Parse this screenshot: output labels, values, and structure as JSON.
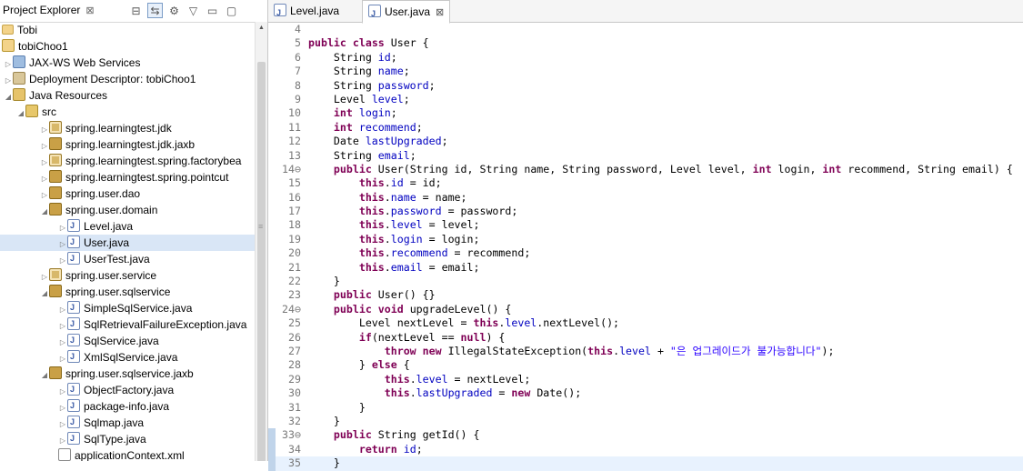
{
  "explorer": {
    "title": "Project Explorer",
    "close_glyph": "⊠",
    "toolbar": [
      {
        "icon": "collapse-all-icon",
        "glyph": "⊟",
        "active": false
      },
      {
        "icon": "link-with-editor-icon",
        "glyph": "⇆",
        "active": true
      },
      {
        "icon": "filter-icon",
        "glyph": "⚙",
        "active": false
      },
      {
        "icon": "view-menu-icon",
        "glyph": "▽",
        "active": false
      },
      {
        "icon": "minimize-icon",
        "glyph": "▭",
        "active": false
      },
      {
        "icon": "maximize-icon",
        "glyph": "▢",
        "active": false
      }
    ],
    "tree": [
      {
        "label": "Tobi",
        "indent": 0,
        "toggle": "",
        "icon": "folder"
      },
      {
        "label": "tobiChoo1",
        "indent": 0,
        "toggle": "",
        "icon": "project"
      },
      {
        "label": "JAX-WS Web Services",
        "indent": 1,
        "toggle": "▷",
        "icon": "ws"
      },
      {
        "label": "Deployment Descriptor: tobiChoo1",
        "indent": 1,
        "toggle": "▷",
        "icon": "dd"
      },
      {
        "label": "Java Resources",
        "indent": 1,
        "toggle": "◢",
        "icon": "jr"
      },
      {
        "label": "src",
        "indent": 2,
        "toggle": "◢",
        "icon": "src"
      },
      {
        "label": "spring.learningtest.jdk",
        "indent": 3,
        "toggle": "▷",
        "icon": "pkgw"
      },
      {
        "label": "spring.learningtest.jdk.jaxb",
        "indent": 3,
        "toggle": "▷",
        "icon": "pkg"
      },
      {
        "label": "spring.learningtest.spring.factorybea",
        "indent": 3,
        "toggle": "▷",
        "icon": "pkgw"
      },
      {
        "label": "spring.learningtest.spring.pointcut",
        "indent": 3,
        "toggle": "▷",
        "icon": "pkg"
      },
      {
        "label": "spring.user.dao",
        "indent": 3,
        "toggle": "▷",
        "icon": "pkg"
      },
      {
        "label": "spring.user.domain",
        "indent": 3,
        "toggle": "◢",
        "icon": "pkg"
      },
      {
        "label": "Level.java",
        "indent": 4,
        "toggle": "▷",
        "icon": "java"
      },
      {
        "label": "User.java",
        "indent": 4,
        "toggle": "▷",
        "icon": "java",
        "selected": true
      },
      {
        "label": "UserTest.java",
        "indent": 4,
        "toggle": "▷",
        "icon": "java"
      },
      {
        "label": "spring.user.service",
        "indent": 3,
        "toggle": "▷",
        "icon": "pkgw"
      },
      {
        "label": "spring.user.sqlservice",
        "indent": 3,
        "toggle": "◢",
        "icon": "pkg"
      },
      {
        "label": "SimpleSqlService.java",
        "indent": 4,
        "toggle": "▷",
        "icon": "java"
      },
      {
        "label": "SqlRetrievalFailureException.java",
        "indent": 4,
        "toggle": "▷",
        "icon": "java"
      },
      {
        "label": "SqlService.java",
        "indent": 4,
        "toggle": "▷",
        "icon": "java"
      },
      {
        "label": "XmlSqlService.java",
        "indent": 4,
        "toggle": "▷",
        "icon": "java"
      },
      {
        "label": "spring.user.sqlservice.jaxb",
        "indent": 3,
        "toggle": "◢",
        "icon": "pkg"
      },
      {
        "label": "ObjectFactory.java",
        "indent": 4,
        "toggle": "▷",
        "icon": "java"
      },
      {
        "label": "package-info.java",
        "indent": 4,
        "toggle": "▷",
        "icon": "java"
      },
      {
        "label": "Sqlmap.java",
        "indent": 4,
        "toggle": "▷",
        "icon": "java"
      },
      {
        "label": "SqlType.java",
        "indent": 4,
        "toggle": "▷",
        "icon": "java"
      },
      {
        "label": "applicationContext.xml",
        "indent": 4,
        "toggle": "",
        "icon": "xml"
      }
    ]
  },
  "editor": {
    "tabs": [
      {
        "label": "Level.java",
        "active": false
      },
      {
        "label": "User.java",
        "active": true,
        "close": "⊠"
      }
    ],
    "lines": [
      {
        "n": "4",
        "code": ""
      },
      {
        "n": "5",
        "code": "<kw>public</kw> <kw>class</kw> User {"
      },
      {
        "n": "6",
        "code": "    String <f>id</f>;"
      },
      {
        "n": "7",
        "code": "    String <f>name</f>;"
      },
      {
        "n": "8",
        "code": "    String <f>password</f>;"
      },
      {
        "n": "9",
        "code": "    Level <f>level</f>;"
      },
      {
        "n": "10",
        "code": "    <kw>int</kw> <f>login</f>;"
      },
      {
        "n": "11",
        "code": "    <kw>int</kw> <f>recommend</f>;"
      },
      {
        "n": "12",
        "code": "    Date <f>lastUpgraded</f>;"
      },
      {
        "n": "13",
        "code": "    String <f>email</f>;"
      },
      {
        "n": "14⊖",
        "code": "    <kw>public</kw> User(String id, String name, String password, Level level, <kw>int</kw> login, <kw>int</kw> recommend, String email) {"
      },
      {
        "n": "15",
        "code": "        <kw>this</kw>.<f>id</f> = id;"
      },
      {
        "n": "16",
        "code": "        <kw>this</kw>.<f>name</f> = name;"
      },
      {
        "n": "17",
        "code": "        <kw>this</kw>.<f>password</f> = password;"
      },
      {
        "n": "18",
        "code": "        <kw>this</kw>.<f>level</f> = level;"
      },
      {
        "n": "19",
        "code": "        <kw>this</kw>.<f>login</f> = login;"
      },
      {
        "n": "20",
        "code": "        <kw>this</kw>.<f>recommend</f> = recommend;"
      },
      {
        "n": "21",
        "code": "        <kw>this</kw>.<f>email</f> = email;"
      },
      {
        "n": "22",
        "code": "    }"
      },
      {
        "n": "23",
        "code": "    <kw>public</kw> User() {}"
      },
      {
        "n": "24⊖",
        "code": "    <kw>public</kw> <kw>void</kw> upgradeLevel() {"
      },
      {
        "n": "25",
        "code": "        Level nextLevel = <kw>this</kw>.<f>level</f>.nextLevel();"
      },
      {
        "n": "26",
        "code": "        <kw>if</kw>(nextLevel == <kw>null</kw>) {"
      },
      {
        "n": "27",
        "code": "            <kw>throw</kw> <kw>new</kw> IllegalStateException(<kw>this</kw>.<f>level</f> + <s>\"은 업그레이드가 불가능합니다\"</s>);"
      },
      {
        "n": "28",
        "code": "        } <kw>else</kw> {"
      },
      {
        "n": "29",
        "code": "            <kw>this</kw>.<f>level</f> = nextLevel;"
      },
      {
        "n": "30",
        "code": "            <kw>this</kw>.<f>lastUpgraded</f> = <kw>new</kw> Date();"
      },
      {
        "n": "31",
        "code": "        }"
      },
      {
        "n": "32",
        "code": "    }"
      },
      {
        "n": "33⊖",
        "code": "    <kw>public</kw> String getId() {",
        "gutter": true
      },
      {
        "n": "34",
        "code": "        <kw>return</kw> <f>id</f>;",
        "gutter": true
      },
      {
        "n": "35",
        "code": "    }",
        "gutter": true,
        "highlight": true
      }
    ]
  }
}
